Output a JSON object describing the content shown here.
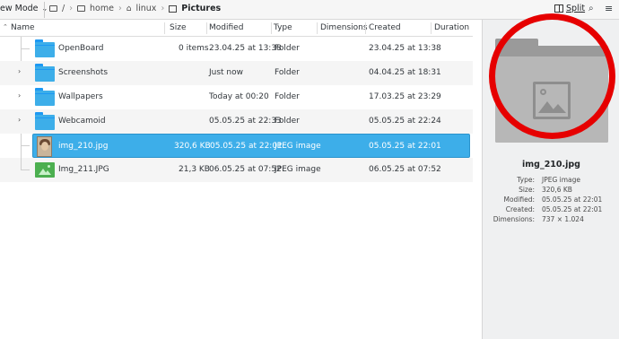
{
  "toolbar": {
    "view_mode_label": "ew Mode",
    "breadcrumb": [
      {
        "label": "/",
        "icon": "root-folder-icon"
      },
      {
        "label": "home",
        "icon": "folder-icon"
      },
      {
        "label": "linux",
        "icon": "home-icon"
      },
      {
        "label": "Pictures",
        "icon": "pictures-icon"
      }
    ],
    "split_label": "Split"
  },
  "columns": [
    "Name",
    "Size",
    "Modified",
    "Type",
    "Dimensions",
    "Created",
    "Duration"
  ],
  "files": [
    {
      "name": "OpenBoard",
      "size": "0 items",
      "modified": "23.04.25 at 13:38",
      "type": "Folder",
      "dimensions": "",
      "created": "23.04.25 at 13:38",
      "expander": "",
      "icon": "folder-icon"
    },
    {
      "name": "Screenshots",
      "size": "",
      "modified": "Just now",
      "type": "Folder",
      "dimensions": "",
      "created": "04.04.25 at 18:31",
      "expander": "›",
      "icon": "folder-icon"
    },
    {
      "name": "Wallpapers",
      "size": "",
      "modified": "Today at 00:20",
      "type": "Folder",
      "dimensions": "",
      "created": "17.03.25 at 23:29",
      "expander": "›",
      "icon": "folder-icon"
    },
    {
      "name": "Webcamoid",
      "size": "",
      "modified": "05.05.25 at 22:33",
      "type": "Folder",
      "dimensions": "",
      "created": "05.05.25 at 22:24",
      "expander": "›",
      "icon": "folder-icon"
    },
    {
      "name": "img_210.jpg",
      "size": "320,6 KB",
      "modified": "05.05.25 at 22:01",
      "type": "JPEG image",
      "dimensions": "",
      "created": "05.05.25 at 22:01",
      "expander": "",
      "icon": "photo-thumbnail-icon"
    },
    {
      "name": "Img_211.JPG",
      "size": "21,3 KB",
      "modified": "06.05.25 at 07:52",
      "type": "JPEG image",
      "dimensions": "",
      "created": "06.05.25 at 07:52",
      "expander": "",
      "icon": "image-thumbnail-icon"
    }
  ],
  "info": {
    "filename": "img_210.jpg",
    "details": [
      {
        "key": "Type:",
        "value": "JPEG image"
      },
      {
        "key": "Size:",
        "value": "320,6 KB"
      },
      {
        "key": "Modified:",
        "value": "05.05.25 at 22:01"
      },
      {
        "key": "Created:",
        "value": "05.05.25 at 22:01"
      },
      {
        "key": "Dimensions:",
        "value": "737 × 1.024"
      }
    ]
  },
  "colors": {
    "selection": "#3daee9",
    "folder": "#3daee9",
    "highlight_circle": "#e60000"
  }
}
